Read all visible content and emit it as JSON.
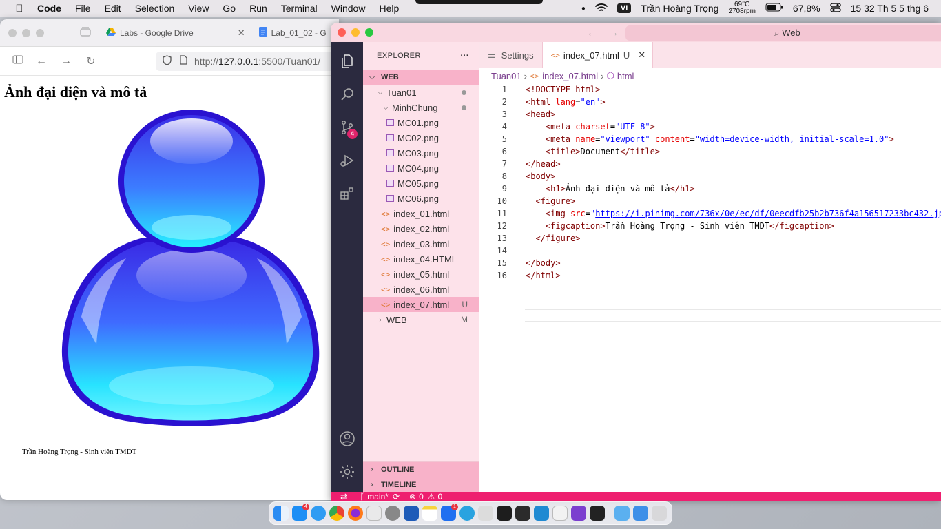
{
  "menubar": {
    "items": [
      "Code",
      "File",
      "Edit",
      "Selection",
      "View",
      "Go",
      "Run",
      "Terminal",
      "Window",
      "Help"
    ],
    "temp": "69°C",
    "rpm": "2708rpm",
    "input_source": "VI",
    "user": "Trần Hoàng Trọng",
    "battery": "67,8%",
    "clock": "15 32 Th 5 5 thg 6"
  },
  "browser": {
    "tabs": [
      {
        "label": "Labs - Google Drive"
      },
      {
        "label": "Lab_01_02 - G"
      }
    ],
    "url_prefix": "http://",
    "url_host": "127.0.0.1",
    "url_rest": ":5500/Tuan01/",
    "page_heading": "Ảnh đại diện và mô tả",
    "figcaption": "Trần Hoàng Trọng - Sinh viên TMDT"
  },
  "vscode": {
    "command_center": "Web",
    "explorer_title": "EXPLORER",
    "explorer_more": "···",
    "section_web": "WEB",
    "tree": [
      {
        "label": "Tuan01",
        "kind": "folder",
        "level": 1,
        "status": "dot"
      },
      {
        "label": "MinhChung",
        "kind": "folder",
        "level": 2,
        "status": "dot"
      },
      {
        "label": "MC01.png",
        "kind": "image",
        "level": 3,
        "status": ""
      },
      {
        "label": "MC02.png",
        "kind": "image",
        "level": 3,
        "status": ""
      },
      {
        "label": "MC03.png",
        "kind": "image",
        "level": 3,
        "status": ""
      },
      {
        "label": "MC04.png",
        "kind": "image",
        "level": 3,
        "status": ""
      },
      {
        "label": "MC05.png",
        "kind": "image",
        "level": 3,
        "status": ""
      },
      {
        "label": "MC06.png",
        "kind": "image",
        "level": 3,
        "status": ""
      },
      {
        "label": "index_01.html",
        "kind": "html",
        "level": 2,
        "status": ""
      },
      {
        "label": "index_02.html",
        "kind": "html",
        "level": 2,
        "status": ""
      },
      {
        "label": "index_03.html",
        "kind": "html",
        "level": 2,
        "status": ""
      },
      {
        "label": "index_04.HTML",
        "kind": "html",
        "level": 2,
        "status": ""
      },
      {
        "label": "index_05.html",
        "kind": "html",
        "level": 2,
        "status": ""
      },
      {
        "label": "index_06.html",
        "kind": "html",
        "level": 2,
        "status": ""
      },
      {
        "label": "index_07.html",
        "kind": "html",
        "level": 2,
        "status": "U",
        "selected": true
      },
      {
        "label": "WEB",
        "kind": "folder-collapsed",
        "level": 1,
        "status": "M"
      }
    ],
    "outline": "OUTLINE",
    "timeline": "TIMELINE",
    "tabs": [
      {
        "label": "Settings",
        "active": false
      },
      {
        "label": "index_07.html",
        "active": true,
        "modified": "U"
      }
    ],
    "breadcrumb": [
      "Tuan01",
      "index_07.html",
      "html"
    ],
    "scm_badge": "4",
    "status_branch": "main*",
    "status_errors": "0",
    "status_warnings": "0"
  }
}
